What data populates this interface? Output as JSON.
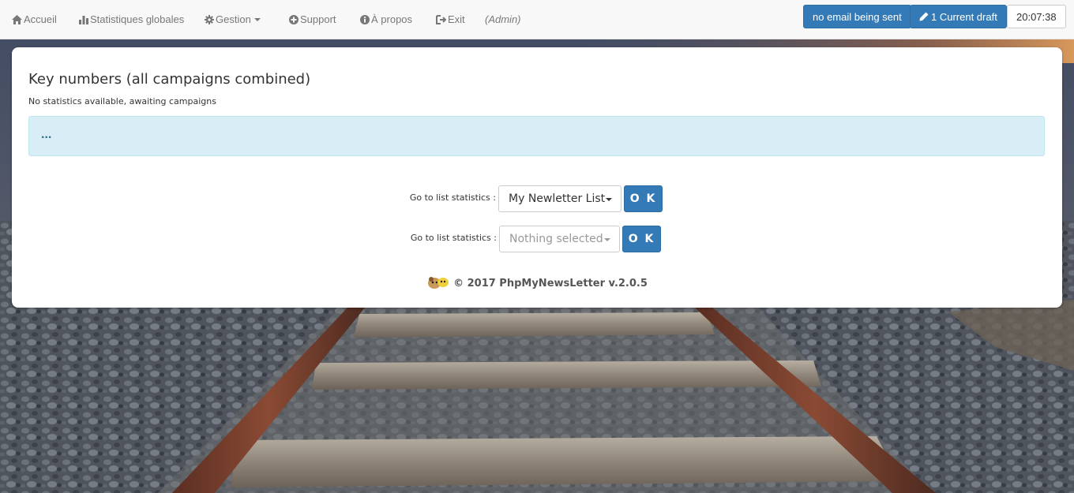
{
  "nav": {
    "home": "Accueil",
    "stats": "Statistiques globales",
    "manage": "Gestion",
    "support": "Support",
    "about": "À propos",
    "exit": "Exit",
    "admin": "(Admin)"
  },
  "status": {
    "email_status": "no email being sent",
    "draft": "1 Current draft",
    "clock": "20:07:38"
  },
  "card": {
    "title": "Key numbers (all campaigns combined)",
    "subtitle": "No statistics available, awaiting campaigns",
    "info_text": "..."
  },
  "list_stats": [
    {
      "label": "Go to list statistics :",
      "selected": "My Newletter List",
      "ok": "O K"
    },
    {
      "label": "Go to list statistics :",
      "placeholder": "Nothing selected",
      "ok": "O K"
    }
  ],
  "footer": {
    "text": "© 2017 PhpMyNewsLetter v.2.0.5"
  },
  "colors": {
    "primary": "#337ab7",
    "info_bg": "#d9edf7",
    "navbar_bg": "#f8f8f8"
  }
}
